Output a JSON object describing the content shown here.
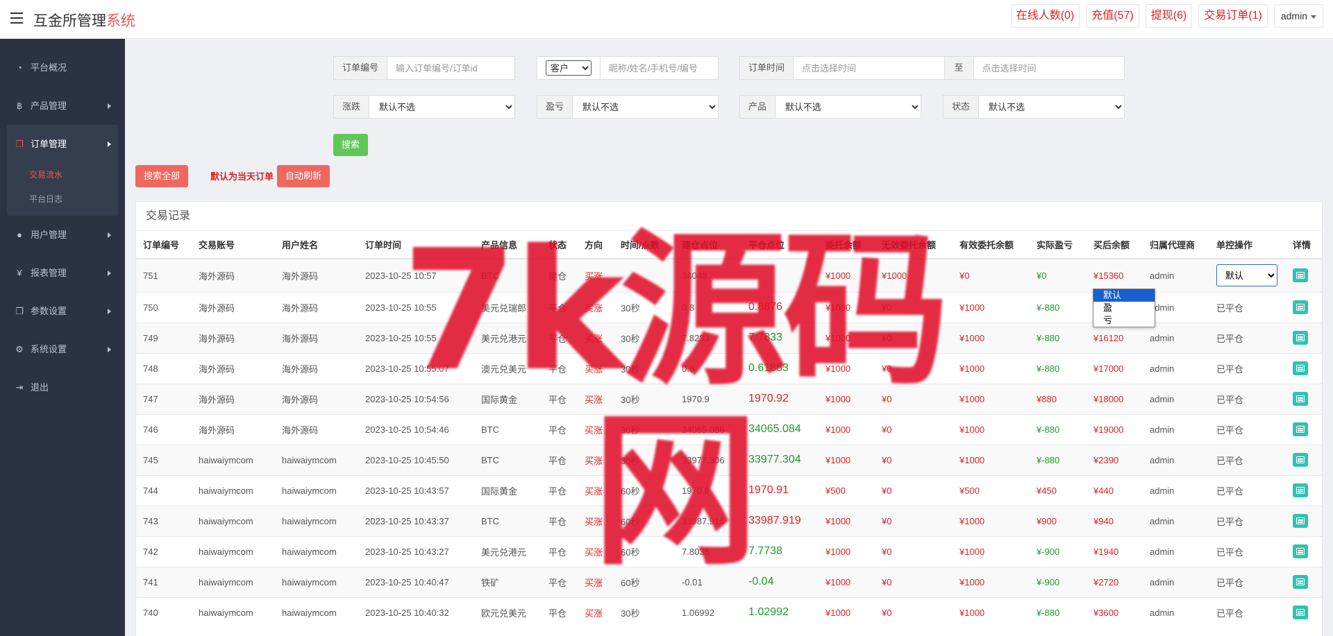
{
  "app": {
    "title_main": "互金所管理",
    "title_accent": "系统"
  },
  "topbar": {
    "online": "在线人数(0)",
    "recharge": "充值(57)",
    "withdraw": "提现(6)",
    "orders": "交易订单(1)",
    "user": "admin"
  },
  "sidebar": {
    "items": [
      {
        "label": "平台概况",
        "icon": "dashboard-icon"
      },
      {
        "label": "产品管理",
        "icon": "bitcoin-icon"
      },
      {
        "label": "订单管理",
        "icon": "copy-icon"
      },
      {
        "label": "用户管理",
        "icon": "user-icon"
      },
      {
        "label": "报表管理",
        "icon": "yen-icon"
      },
      {
        "label": "参数设置",
        "icon": "copy-icon"
      },
      {
        "label": "系统设置",
        "icon": "gears-icon"
      },
      {
        "label": "退出",
        "icon": "sign-out-icon"
      }
    ],
    "sub_items": [
      "交易流水",
      "平台日志"
    ]
  },
  "filters": {
    "order_no_label": "订单编号",
    "order_no_placeholder": "输入订单编号/订单id",
    "customer_select": "客户",
    "customer_placeholder": "昵称/姓名/手机号/编号",
    "time_label": "订单时间",
    "time_start_placeholder": "点击选择时间",
    "time_to": "至",
    "time_end_placeholder": "点击选择时间",
    "rise_label": "涨跌",
    "profit_label": "盈亏",
    "product_label": "产品",
    "status_label": "状态",
    "default_option": "默认不选",
    "search_btn": "搜索",
    "search_all_btn": "搜索全部",
    "today_note": "默认为当天订单",
    "auto_refresh_btn": "自动刷新"
  },
  "panel": {
    "title": "交易记录",
    "columns": [
      "订单编号",
      "交易账号",
      "用户姓名",
      "订单时间",
      "产品信息",
      "状态",
      "方向",
      "时间/点数",
      "建仓点位",
      "平仓点位",
      "委托余额",
      "无效委托余额",
      "有效委托余额",
      "实际盈亏",
      "买后余额",
      "归属代理商",
      "单控操作",
      "详情"
    ],
    "ctrl_default": "默认",
    "dropdown_options": [
      "默认",
      "盈",
      "亏"
    ],
    "rows": [
      {
        "id": "751",
        "account": "海外源码",
        "name": "海外源码",
        "time": "2023-10-25 10:57",
        "product": "BTC",
        "status": "建仓",
        "direction": "买涨",
        "duration": "",
        "open": "34048",
        "close": "",
        "close_color": "red",
        "entrust": "¥1000",
        "invalid": "¥1000",
        "valid": "¥0",
        "pnl": "¥0",
        "pnl_color": "green",
        "after": "¥15360",
        "agent": "admin",
        "ctrl": "select"
      },
      {
        "id": "750",
        "account": "海外源码",
        "name": "海外源码",
        "time": "2023-10-25 10:55",
        "product": "美元兑瑞郎",
        "status": "平仓",
        "direction": "买涨",
        "duration": "30秒",
        "open": "0.8",
        "close": "0.8876",
        "close_color": "red",
        "entrust": "¥1000",
        "invalid": "¥0",
        "valid": "¥1000",
        "pnl": "¥-880",
        "pnl_color": "green",
        "after": "¥17000",
        "agent": "admin",
        "ctrl": "已平仓"
      },
      {
        "id": "749",
        "account": "海外源码",
        "name": "海外源码",
        "time": "2023-10-25 10:55",
        "product": "美元兑港元",
        "status": "平仓",
        "direction": "买涨",
        "duration": "30秒",
        "open": "7.8233",
        "close": "7.7833",
        "close_color": "green",
        "entrust": "¥1000",
        "invalid": "¥0",
        "valid": "¥1000",
        "pnl": "¥-880",
        "pnl_color": "green",
        "after": "¥16120",
        "agent": "admin",
        "ctrl": "已平仓"
      },
      {
        "id": "748",
        "account": "海外源码",
        "name": "海外源码",
        "time": "2023-10-25 10:55:07",
        "product": "澳元兑美元",
        "status": "平仓",
        "direction": "买涨",
        "duration": "30秒",
        "open": "0.6",
        "close": "0.61883",
        "close_color": "green",
        "entrust": "¥1000",
        "invalid": "¥0",
        "valid": "¥1000",
        "pnl": "¥-880",
        "pnl_color": "green",
        "after": "¥17000",
        "agent": "admin",
        "ctrl": "已平仓"
      },
      {
        "id": "747",
        "account": "海外源码",
        "name": "海外源码",
        "time": "2023-10-25 10:54:56",
        "product": "国际黄金",
        "status": "平仓",
        "direction": "买涨",
        "duration": "30秒",
        "open": "1970.9",
        "close": "1970.92",
        "close_color": "red",
        "entrust": "¥1000",
        "invalid": "¥0",
        "valid": "¥1000",
        "pnl": "¥880",
        "pnl_color": "red",
        "after": "¥18000",
        "agent": "admin",
        "ctrl": "已平仓"
      },
      {
        "id": "746",
        "account": "海外源码",
        "name": "海外源码",
        "time": "2023-10-25 10:54:46",
        "product": "BTC",
        "status": "平仓",
        "direction": "买涨",
        "duration": "30秒",
        "open": "34065.086",
        "close": "34065.084",
        "close_color": "green",
        "entrust": "¥1000",
        "invalid": "¥0",
        "valid": "¥1000",
        "pnl": "¥-880",
        "pnl_color": "green",
        "after": "¥19000",
        "agent": "admin",
        "ctrl": "已平仓"
      },
      {
        "id": "745",
        "account": "haiwaiymcom",
        "name": "haiwaiymcom",
        "time": "2023-10-25 10:45:50",
        "product": "BTC",
        "status": "平仓",
        "direction": "买涨",
        "duration": "30秒",
        "open": "33977.306",
        "close": "33977.304",
        "close_color": "green",
        "entrust": "¥1000",
        "invalid": "¥0",
        "valid": "¥1000",
        "pnl": "¥-880",
        "pnl_color": "green",
        "after": "¥2390",
        "agent": "admin",
        "ctrl": "已平仓"
      },
      {
        "id": "744",
        "account": "haiwaiymcom",
        "name": "haiwaiymcom",
        "time": "2023-10-25 10:43:57",
        "product": "国际黄金",
        "status": "平仓",
        "direction": "买涨",
        "duration": "60秒",
        "open": "1970.9",
        "close": "1970.91",
        "close_color": "red",
        "entrust": "¥500",
        "invalid": "¥0",
        "valid": "¥500",
        "pnl": "¥450",
        "pnl_color": "red",
        "after": "¥440",
        "agent": "admin",
        "ctrl": "已平仓"
      },
      {
        "id": "743",
        "account": "haiwaiymcom",
        "name": "haiwaiymcom",
        "time": "2023-10-25 10:43:37",
        "product": "BTC",
        "status": "平仓",
        "direction": "买涨",
        "duration": "60秒",
        "open": "33987.916",
        "close": "33987.919",
        "close_color": "red",
        "entrust": "¥1000",
        "invalid": "¥0",
        "valid": "¥1000",
        "pnl": "¥900",
        "pnl_color": "red",
        "after": "¥940",
        "agent": "admin",
        "ctrl": "已平仓"
      },
      {
        "id": "742",
        "account": "haiwaiymcom",
        "name": "haiwaiymcom",
        "time": "2023-10-25 10:43:27",
        "product": "美元兑港元",
        "status": "平仓",
        "direction": "买涨",
        "duration": "60秒",
        "open": "7.8038",
        "close": "7.7738",
        "close_color": "green",
        "entrust": "¥1000",
        "invalid": "¥0",
        "valid": "¥1000",
        "pnl": "¥-900",
        "pnl_color": "green",
        "after": "¥1940",
        "agent": "admin",
        "ctrl": "已平仓"
      },
      {
        "id": "741",
        "account": "haiwaiymcom",
        "name": "haiwaiymcom",
        "time": "2023-10-25 10:40:47",
        "product": "铁矿",
        "status": "平仓",
        "direction": "买涨",
        "duration": "60秒",
        "open": "-0.01",
        "close": "-0.04",
        "close_color": "green",
        "entrust": "¥1000",
        "invalid": "¥0",
        "valid": "¥1000",
        "pnl": "¥-900",
        "pnl_color": "green",
        "after": "¥2720",
        "agent": "admin",
        "ctrl": "已平仓"
      },
      {
        "id": "740",
        "account": "haiwaiymcom",
        "name": "haiwaiymcom",
        "time": "2023-10-25 10:40:32",
        "product": "欧元兑美元",
        "status": "平仓",
        "direction": "买涨",
        "duration": "30秒",
        "open": "1.06992",
        "close": "1.02992",
        "close_color": "green",
        "entrust": "¥1000",
        "invalid": "¥0",
        "valid": "¥1000",
        "pnl": "¥-880",
        "pnl_color": "green",
        "after": "¥3600",
        "agent": "admin",
        "ctrl": "已平仓"
      }
    ]
  },
  "watermark": "7k源码网",
  "colors": {
    "accent": "#f0534e",
    "sidebar_bg": "#2b3342",
    "profit_red": "#e02020",
    "loss_green": "#1f9a2c",
    "detail_teal": "#2fc3b0"
  }
}
